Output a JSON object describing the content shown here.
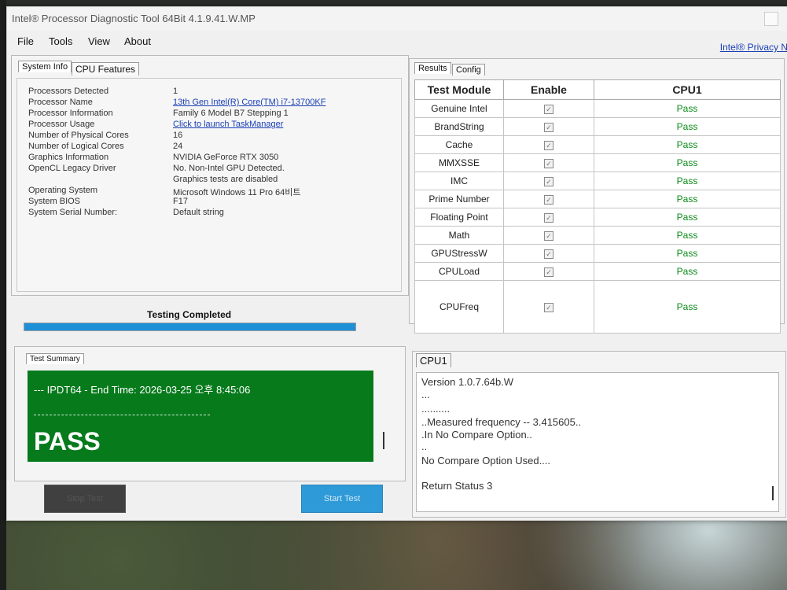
{
  "window": {
    "title": "Intel® Processor Diagnostic Tool 64Bit 4.1.9.41.W.MP"
  },
  "menu": {
    "file": "File",
    "tools": "Tools",
    "view": "View",
    "about": "About"
  },
  "privacy_link": "Intel® Privacy N",
  "left_tabs": {
    "system_info": "System Info",
    "cpu_features": "CPU Features"
  },
  "system_info": [
    {
      "label": "Processors Detected",
      "value": "1"
    },
    {
      "label": "Processor Name",
      "value": "13th Gen Intel(R) Core(TM) i7-13700KF",
      "link": true
    },
    {
      "label": "Processor Information",
      "value": "Family 6 Model B7 Stepping 1"
    },
    {
      "label": "Processor Usage",
      "value": "Click to launch TaskManager",
      "link": true
    },
    {
      "label": "Number of Physical Cores",
      "value": "16"
    },
    {
      "label": "Number of Logical Cores",
      "value": "24"
    },
    {
      "label": "Graphics Information",
      "value": "NVIDIA GeForce RTX 3050"
    },
    {
      "label": "OpenCL Legacy Driver",
      "value": "No. Non-Intel GPU Detected."
    },
    {
      "label": "",
      "value": "Graphics tests are disabled"
    },
    {
      "label": "Operating System",
      "value": "Microsoft Windows 11 Pro 64비트"
    },
    {
      "label": "System BIOS",
      "value": "F17"
    },
    {
      "label": "System Serial Number:",
      "value": "Default string"
    }
  ],
  "right_tabs": {
    "results": "Results",
    "config": "Config"
  },
  "results": {
    "headers": {
      "module": "Test Module",
      "enable": "Enable",
      "cpu": "CPU1"
    },
    "rows": [
      {
        "module": "Genuine Intel",
        "status": "Pass"
      },
      {
        "module": "BrandString",
        "status": "Pass"
      },
      {
        "module": "Cache",
        "status": "Pass"
      },
      {
        "module": "MMXSSE",
        "status": "Pass"
      },
      {
        "module": "IMC",
        "status": "Pass"
      },
      {
        "module": "Prime Number",
        "status": "Pass"
      },
      {
        "module": "Floating Point",
        "status": "Pass"
      },
      {
        "module": "Math",
        "status": "Pass"
      },
      {
        "module": "GPUStressW",
        "status": "Pass"
      },
      {
        "module": "CPULoad",
        "status": "Pass"
      },
      {
        "module": "CPUFreq",
        "status": "Pass"
      }
    ]
  },
  "progress": {
    "label": "Testing Completed",
    "fraction": 1.0
  },
  "summary": {
    "tab": "Test Summary",
    "end_time": "--- IPDT64 - End Time: 2026-03-25 오후 8:45:06",
    "result": "PASS"
  },
  "buttons": {
    "stop": "Stop Test",
    "start": "Start Test"
  },
  "cpu_log": {
    "tab": "CPU1",
    "lines": [
      "Version 1.0.7.64b.W",
      "...",
      "..........",
      "..Measured frequency -- 3.415605..",
      ".In No Compare Option..",
      "..",
      "No Compare Option Used....",
      "",
      "Return Status  3"
    ]
  },
  "icons": {
    "check": "checkbox-checked-icon"
  }
}
